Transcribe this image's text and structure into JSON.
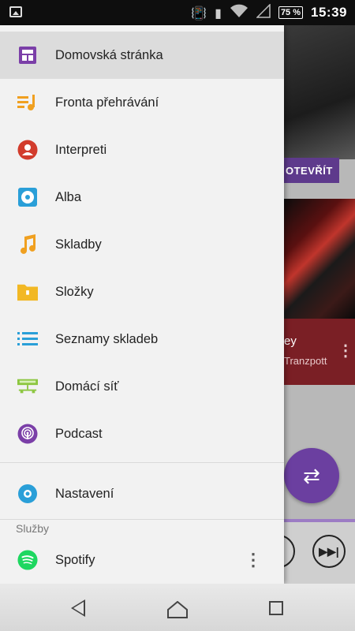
{
  "status_bar": {
    "time": "15:39",
    "battery": "75 %",
    "icons": [
      "gallery-icon",
      "vibrate-icon",
      "battery-saver-icon",
      "wifi-icon",
      "signal-icon"
    ]
  },
  "drawer": {
    "items": [
      {
        "label": "Domovská stránka",
        "icon": "home-tile-icon",
        "color": "#7b3fa8"
      },
      {
        "label": "Fronta přehrávání",
        "icon": "queue-icon",
        "color": "#f0a020"
      },
      {
        "label": "Interpreti",
        "icon": "artist-icon",
        "color": "#d23c2c"
      },
      {
        "label": "Alba",
        "icon": "album-icon",
        "color": "#2a9fd8"
      },
      {
        "label": "Skladby",
        "icon": "song-icon",
        "color": "#f0a020"
      },
      {
        "label": "Složky",
        "icon": "folder-icon",
        "color": "#f2b824"
      },
      {
        "label": "Seznamy skladeb",
        "icon": "playlist-icon",
        "color": "#2a9fd8"
      },
      {
        "label": "Domácí síť",
        "icon": "home-network-icon",
        "color": "#8cc63f"
      },
      {
        "label": "Podcast",
        "icon": "podcast-icon",
        "color": "#7b3fa8"
      }
    ],
    "settings_label": "Nastavení",
    "section_label": "Služby",
    "spotify_label": "Spotify"
  },
  "background_app": {
    "open_button": "OTEVŘÍT",
    "track_title": "ey",
    "track_artist": "Tranzpott"
  }
}
